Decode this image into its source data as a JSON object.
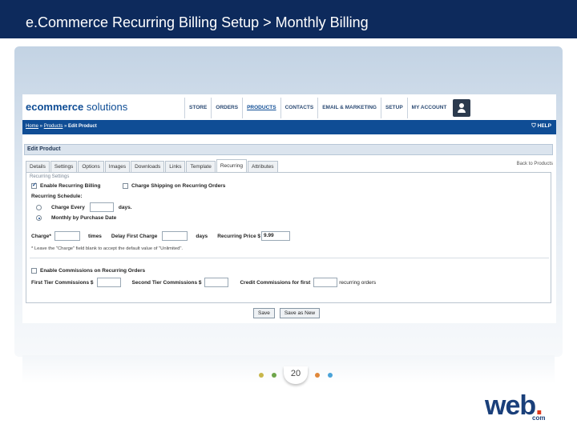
{
  "slide": {
    "title": "e.Commerce Recurring Billing Setup > Monthly Billing",
    "page_number": "20",
    "colors": {
      "header": "#0d2a5c",
      "pager_dots": [
        "#c8b74a",
        "#6ea54a",
        "#e0883a",
        "#4aa3d8"
      ]
    }
  },
  "app": {
    "logo_bold": "ecommerce",
    "logo_light": " solutions",
    "nav": [
      "STORE",
      "ORDERS",
      "PRODUCTS",
      "CONTACTS",
      "EMAIL & MARKETING",
      "SETUP",
      "MY ACCOUNT"
    ],
    "nav_active": "PRODUCTS",
    "breadcrumb": {
      "home": "Home",
      "sep1": " » ",
      "products": "Products",
      "sep2": " » ",
      "current": "Edit Product"
    },
    "help": "HELP",
    "panel_title": "Edit Product",
    "tabs": [
      "Details",
      "Settings",
      "Options",
      "Images",
      "Downloads",
      "Links",
      "Template",
      "Recurring",
      "Attributes"
    ],
    "active_tab": "Recurring",
    "back_link": "Back to Products",
    "form": {
      "section_legend": "Recurring Settings",
      "enable_recurring_label": "Enable Recurring Billing",
      "enable_recurring_checked": true,
      "charge_shipping_label": "Charge Shipping on Recurring Orders",
      "charge_shipping_checked": false,
      "schedule_label": "Recurring Schedule:",
      "charge_every_label": "Charge Every",
      "charge_every_value": "",
      "days_label": "days.",
      "monthly_label": "Monthly by Purchase Date",
      "monthly_selected": true,
      "charge_label": "Charge*",
      "charge_value": "",
      "times_label": "times",
      "delay_label": "Delay First Charge",
      "delay_value": "",
      "delay_days_label": "days",
      "price_label": "Recurring Price $",
      "price_value": "9.99",
      "note": "* Leave the \"Charge\" field blank to accept the default value of \"Unlimited\".",
      "enable_commissions_label": "Enable Commissions on Recurring Orders",
      "enable_commissions_checked": false,
      "first_tier_label": "First Tier Commissions $",
      "second_tier_label": "Second Tier Commissions $",
      "credit_label": "Credit Commissions for first",
      "recurring_orders_label": "recurring orders"
    },
    "buttons": {
      "save": "Save",
      "save_as_new": "Save as New"
    }
  },
  "brand": {
    "logo": "web",
    "logo_dot": ".",
    "logo_sub": "com"
  }
}
